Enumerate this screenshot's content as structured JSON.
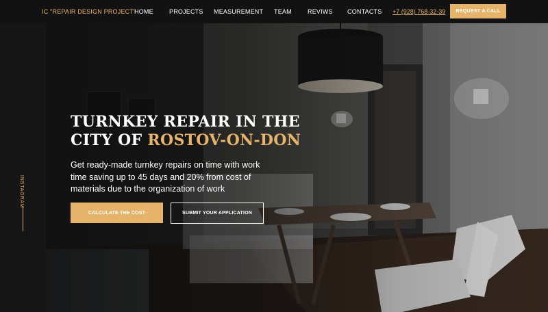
{
  "header": {
    "logo": "IC \"REPAIR DESIGN PROJECT\"",
    "nav": [
      {
        "label": "HOME"
      },
      {
        "label": "PROJECTS"
      },
      {
        "label": "MEASUREMENT"
      },
      {
        "label": "TEAM"
      },
      {
        "label": "REVIWS"
      },
      {
        "label": "CONTACTS"
      }
    ],
    "phone": "+7 (928) 768-32-39",
    "call_button": "REQUEST A CALL"
  },
  "sidebar": {
    "instagram": "INSTAGRAM"
  },
  "hero": {
    "title_line1": "TURNKEY REPAIR IN THE",
    "title_line2_prefix": "CITY OF",
    "title_line2_accent": "ROSTOV-ON-DON",
    "subtitle": "Get ready-made turnkey repairs on time with work time saving up to 45 days and 20% from cost of materials due to the organization of work",
    "primary_button": "CALCULATE THE COST",
    "secondary_button": "SUBMIT YOUR APPLICATION"
  },
  "colors": {
    "accent": "#e6b36a",
    "header_bg": "#121212",
    "text": "#ffffff"
  }
}
